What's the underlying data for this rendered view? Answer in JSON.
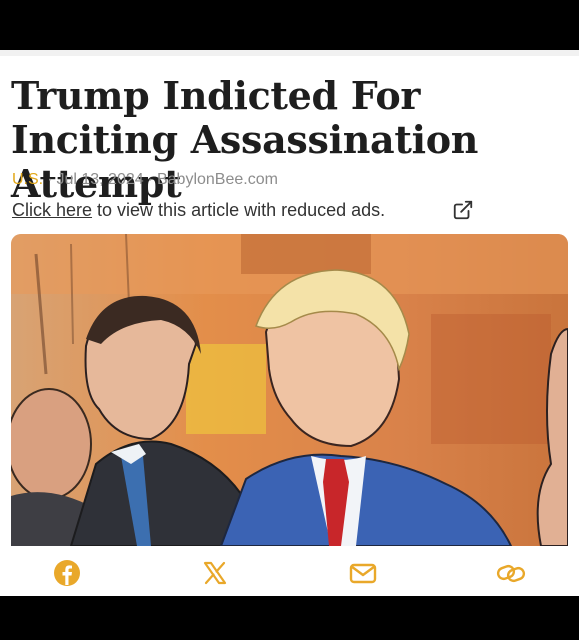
{
  "article": {
    "title": "Trump Indicted For Inciting Assassination Attempt",
    "section": "U.S.",
    "separator": "·",
    "date": "Jul 13, 2024",
    "source": "BabylonBee.com"
  },
  "reduced_ads": {
    "link_text": "Click here",
    "text": " to view this article with reduced ads."
  },
  "icons": {
    "external": "external-link-icon",
    "share": [
      "facebook-icon",
      "x-icon",
      "email-icon",
      "link-icon"
    ]
  },
  "colors": {
    "accent": "#e9a82a",
    "headline": "#1e1e1e",
    "meta": "#8d8d8d"
  }
}
